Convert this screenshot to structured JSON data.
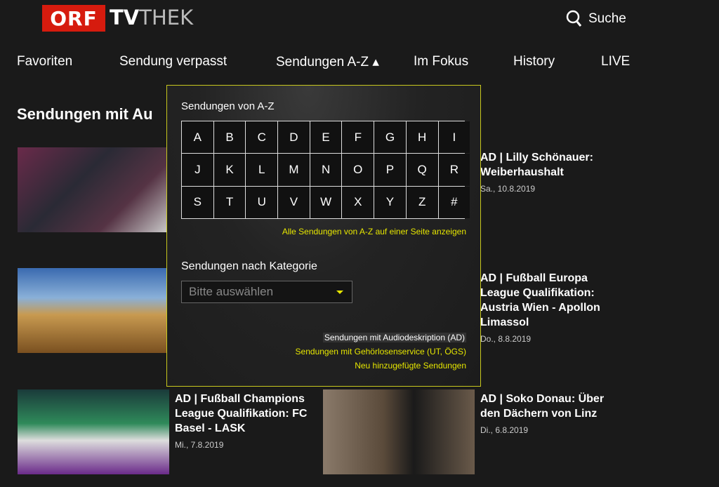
{
  "header": {
    "logo_orf": "ORF",
    "logo_tv": "TV",
    "logo_thek": "THEK",
    "search_label": "Suche",
    "search_icon": "search-icon"
  },
  "nav": [
    {
      "label": "Favoriten"
    },
    {
      "label": "Sendung verpasst"
    },
    {
      "label": "Sendungen A-Z ▴"
    },
    {
      "label": "Im Fokus"
    },
    {
      "label": "History"
    },
    {
      "label": "LIVE"
    }
  ],
  "main": {
    "heading": "Sendungen mit Au",
    "cards": [
      {
        "title": "AD | Lilly Schönauer: Weiberhaushalt",
        "date": "Sa., 10.8.2019"
      },
      {
        "title": "AD | Fußball Europa League Qualifikation: Austria Wien - Apollon Limassol",
        "date": "Do., 8.8.2019"
      },
      {
        "title": "AD | Fußball Champions League Qualifikation: FC Basel - LASK",
        "date": "Mi., 7.8.2019"
      },
      {
        "title": "AD | Soko Donau: Über den Dächern von Linz",
        "date": "Di., 6.8.2019"
      }
    ]
  },
  "dropdown": {
    "az_title": "Sendungen von A-Z",
    "letters": [
      "A",
      "B",
      "C",
      "D",
      "E",
      "F",
      "G",
      "H",
      "I",
      "J",
      "K",
      "L",
      "M",
      "N",
      "O",
      "P",
      "Q",
      "R",
      "S",
      "T",
      "U",
      "V",
      "W",
      "X",
      "Y",
      "Z",
      "#"
    ],
    "all_link": "Alle Sendungen von A-Z auf einer Seite anzeigen",
    "kategorie_title": "Sendungen nach Kategorie",
    "select_placeholder": "Bitte auswählen",
    "links": [
      "Sendungen mit Audiodeskription (AD)",
      "Sendungen mit Gehörlosenservice (UT, ÖGS)",
      "Neu hinzugefügte Sendungen"
    ]
  },
  "colors": {
    "accent": "#e6e600",
    "brand": "#d61b0e",
    "background": "#1a1a1a"
  }
}
